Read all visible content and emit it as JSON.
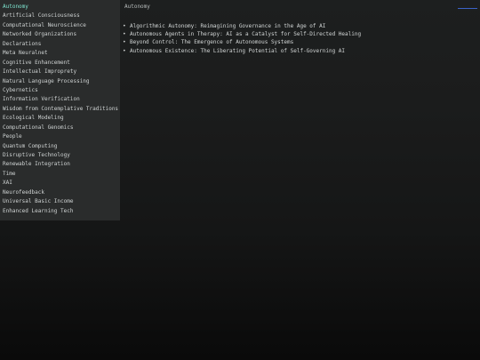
{
  "sidebar": {
    "items": [
      {
        "label": "Autonomy",
        "active": true
      },
      {
        "label": "Artificial Consciousness"
      },
      {
        "label": "Computational Neuroscience"
      },
      {
        "label": "Networked Organizations"
      },
      {
        "label": "Declarations"
      },
      {
        "label": "Meta Neuralnet"
      },
      {
        "label": "Cognitive Enhancement"
      },
      {
        "label": "Intellectual Improprety"
      },
      {
        "label": "Natural Language Processing"
      },
      {
        "label": "Cybernetics"
      },
      {
        "label": "Information Verification"
      },
      {
        "label": "Wisdom from Contemplative Traditions"
      },
      {
        "label": "Ecological Modeling"
      },
      {
        "label": "Computational Genomics"
      },
      {
        "label": "People"
      },
      {
        "label": "Quantum Computing"
      },
      {
        "label": "Disruptive Technology"
      },
      {
        "label": "Renewable Integration"
      },
      {
        "label": "Time"
      },
      {
        "label": "XAI"
      },
      {
        "label": "Neurofeedback"
      },
      {
        "label": "Universal Basic Income"
      },
      {
        "label": "Enhanced Learning Tech"
      }
    ]
  },
  "main": {
    "title": "Autonomy",
    "articles": [
      {
        "title": "Algorithmic Autonomy: Reimagining Governance in the Age of AI"
      },
      {
        "title": "Autonomous Agents in Therapy: AI as a Catalyst for Self-Directed Healing"
      },
      {
        "title": "Beyond Control: The Emergence of Autonomous Systems"
      },
      {
        "title": "Autonomous Existence: The Liberating Potential of Self-Governing AI"
      }
    ]
  },
  "bullet": "•",
  "colors": {
    "active_item": "#7fe7d2",
    "link": "#3b63c7",
    "sidebar_bg": "#2a2c2c"
  }
}
